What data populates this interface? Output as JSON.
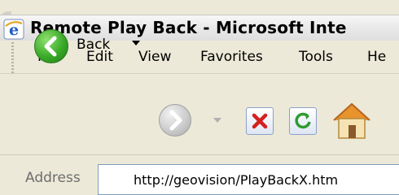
{
  "window": {
    "title": "Remote Play Back - Microsoft Inte",
    "icon": "ie-icon"
  },
  "menu": {
    "items": [
      {
        "label": "File"
      },
      {
        "label": "Edit"
      },
      {
        "label": "View"
      },
      {
        "label": "Favorites"
      },
      {
        "label": "Tools"
      },
      {
        "label": "He"
      }
    ]
  },
  "toolbar": {
    "back_label": "Back",
    "icons": [
      "back-arrow-icon",
      "forward-arrow-icon",
      "stop-icon",
      "refresh-icon",
      "home-icon"
    ]
  },
  "address": {
    "label": "Address",
    "url": "http://geovision/PlayBackX.htm"
  },
  "colors": {
    "back_green": "#3aaa28",
    "stop_red": "#d42020",
    "refresh_green": "#2f9a2f",
    "home_orange": "#e8932c"
  }
}
